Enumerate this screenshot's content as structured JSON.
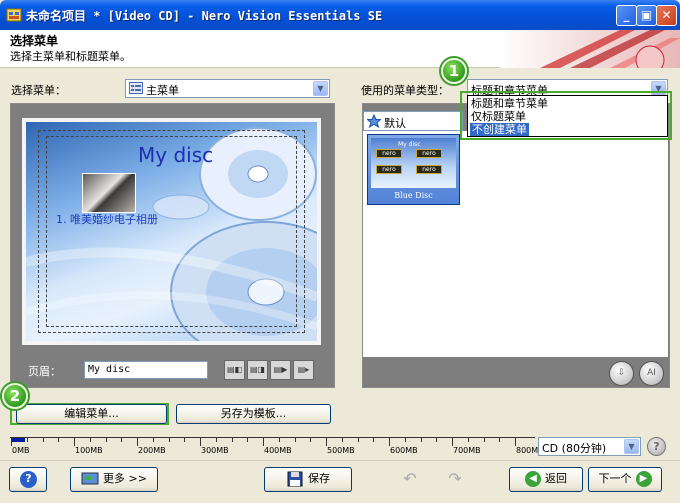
{
  "window": {
    "title": "未命名项目 * [Video CD] - Nero Vision Essentials SE"
  },
  "header": {
    "title": "选择菜单",
    "subtitle": "选择主菜单和标题菜单。"
  },
  "left": {
    "select_label": "选择菜单：",
    "select_value": "主菜单",
    "preview": {
      "disc_title": "My disc",
      "album_item": "1. 唯美婚纱电子相册"
    },
    "footer_label": "页眉：",
    "footer_value": "My disc",
    "edit_button": "编辑菜单...",
    "save_template_button": "另存为模板..."
  },
  "right": {
    "type_label": "使用的菜单类型：",
    "type_value": "标题和章节菜单",
    "type_options": [
      "标题和章节菜单",
      "仅标题菜单",
      "不创建菜单"
    ],
    "selected_option_index": 2,
    "default_value": "默认",
    "thumb_caption": "Blue Disc",
    "thumb_title": "My disc",
    "thumb_item_label": "nero"
  },
  "callouts": {
    "one": "1",
    "two": "2"
  },
  "ruler": {
    "labels": [
      "0MB",
      "100MB",
      "200MB",
      "300MB",
      "400MB",
      "500MB",
      "600MB",
      "700MB",
      "800MB"
    ],
    "used_fraction": 0.006,
    "disc_value": "CD (80分钟)"
  },
  "bottom": {
    "more_button": "更多 >>",
    "save_button": "保存",
    "back_button": "返回",
    "next_button": "下一个"
  },
  "icons": {
    "help": "?",
    "restore": "▣"
  },
  "colors": {
    "titlebar": "#0450d6",
    "callout": "#4bab2e",
    "selection": "#316ac5",
    "panel": "#7e7e7e"
  }
}
